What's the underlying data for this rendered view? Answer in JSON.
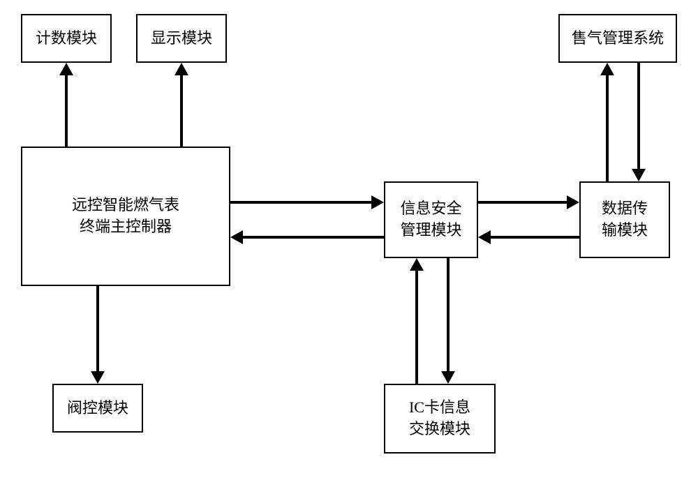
{
  "boxes": {
    "counting": "计数模块",
    "display": "显示模块",
    "controller": "远控智能燃气表\n终端主控制器",
    "valve": "阀控模块",
    "security": "信息安全\n管理模块",
    "iccard": "IC卡信息\n交换模块",
    "datatransfer": "数据传\n输模块",
    "gassales": "售气管理系统"
  }
}
